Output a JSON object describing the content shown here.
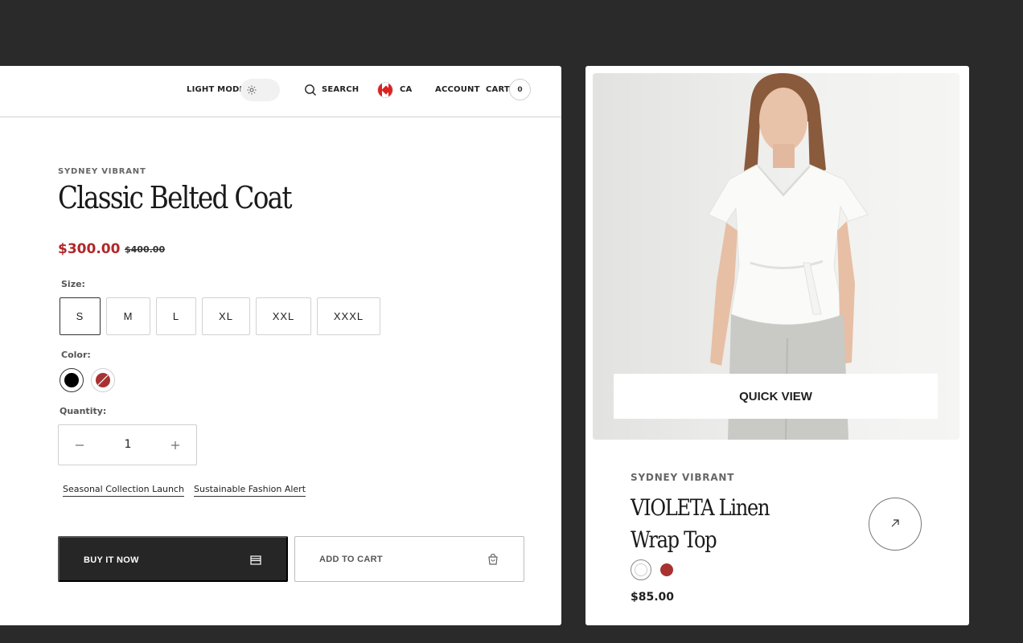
{
  "header": {
    "light_mode_label": "LIGHT MODE",
    "search_label": "SEARCH",
    "region_label": "CA",
    "account_label": "ACCOUNT",
    "cart_label": "CART",
    "cart_count": "0"
  },
  "product": {
    "brand": "SYDNEY VIBRANT",
    "title": "Classic Belted Coat",
    "price": "$300.00",
    "compare_price": "$400.00",
    "size_label": "Size:",
    "sizes": [
      "S",
      "M",
      "L",
      "XL",
      "XXL",
      "XXXL"
    ],
    "selected_size": "S",
    "color_label": "Color:",
    "colors": [
      "#000000",
      "#a83232"
    ],
    "quantity_label": "Quantity:",
    "quantity": "1",
    "tags": [
      "Seasonal Collection Launch",
      "Sustainable Fashion Alert"
    ],
    "buy_now_label": "BUY IT NOW",
    "add_to_cart_label": "ADD TO CART"
  },
  "card": {
    "quick_view_label": "QUICK VIEW",
    "brand": "SYDNEY VIBRANT",
    "title": "VIOLETA Linen Wrap Top",
    "price": "$85.00",
    "colors": [
      "#ffffff",
      "#a83232"
    ]
  },
  "icons": {
    "theme": "sun-icon",
    "search": "search-icon",
    "region": "canada-flag-icon",
    "buy": "card-icon",
    "cart": "shopping-bag-icon",
    "open": "arrow-up-right-icon"
  },
  "colors": {
    "background": "#2a2a2a",
    "sale_price": "#b0282a",
    "primary_button": "#262626"
  }
}
